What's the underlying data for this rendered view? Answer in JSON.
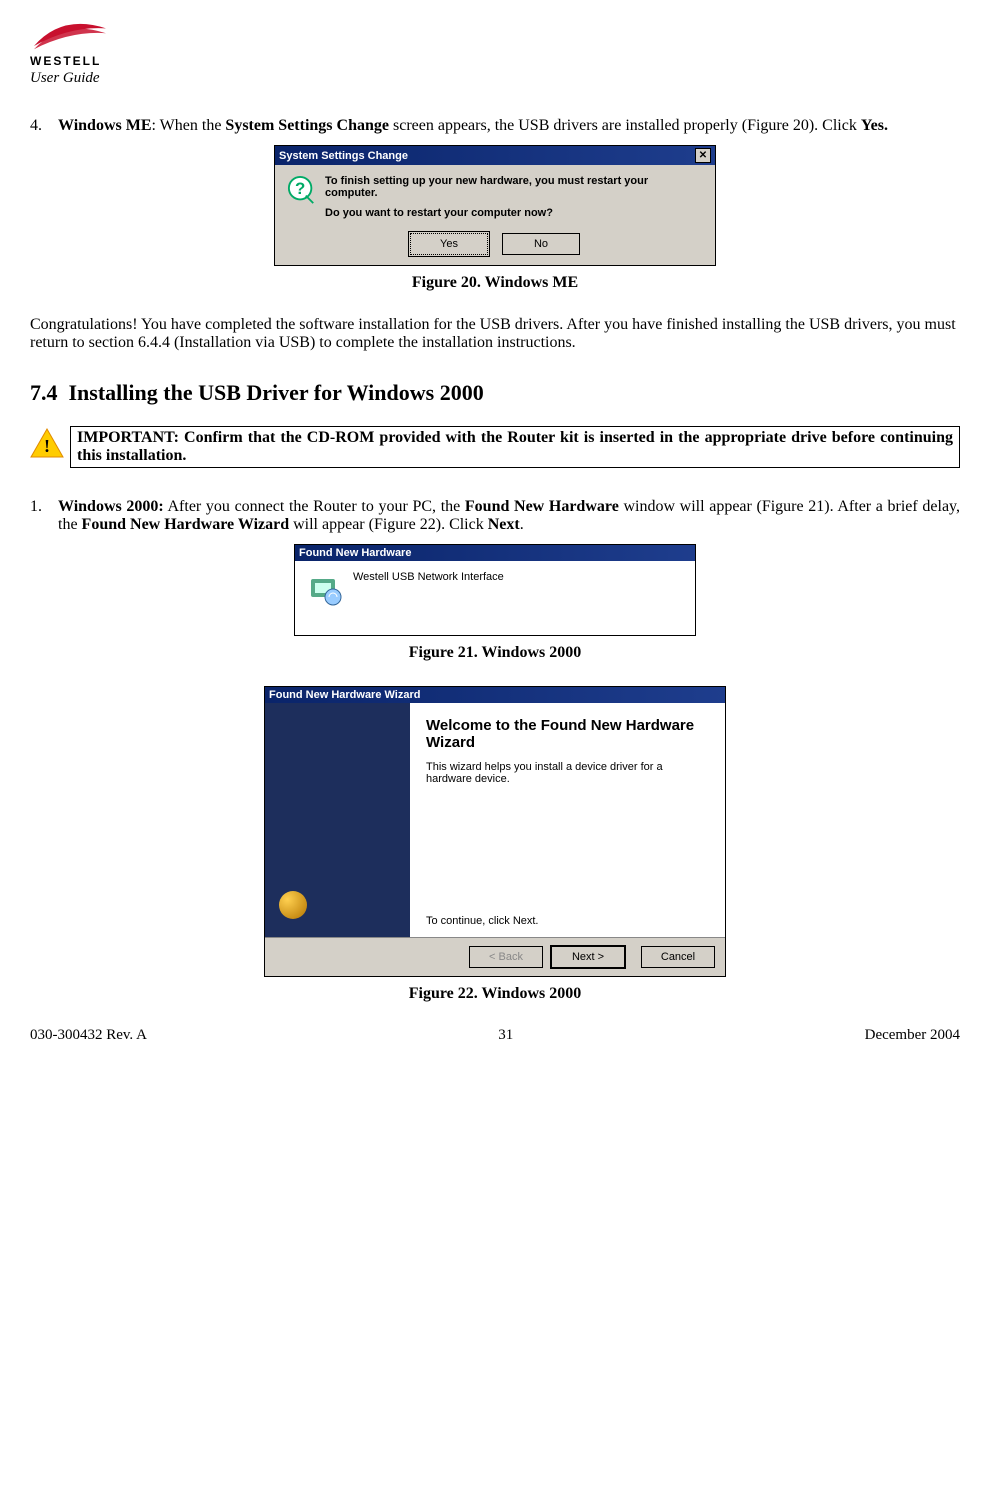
{
  "header": {
    "brand": "WESTELL",
    "subtitle": "User Guide"
  },
  "step4": {
    "number": "4.",
    "bold_os": "Windows ME",
    "text_after_os": ": When the ",
    "bold_screen": "System Settings Change",
    "text_tail": " screen appears, the USB drivers are installed properly (Figure 20). Click ",
    "bold_yes": "Yes."
  },
  "fig20": {
    "dialog_title": "System Settings Change",
    "line1": "To finish setting up your new hardware, you must restart your computer.",
    "line2": "Do you want to restart your computer now?",
    "btn_yes": "Yes",
    "btn_no": "No",
    "caption": "Figure 20. Windows ME"
  },
  "congrats": "Congratulations! You have completed the software installation for the USB drivers. After you have finished installing the USB drivers, you must return to section 6.4.4 (Installation via USB) to complete the installation instructions.",
  "section": {
    "num": "7.4",
    "title": "Installing the USB Driver for Windows 2000"
  },
  "important": "IMPORTANT: Confirm that the CD-ROM provided with the Router kit is inserted in the appropriate drive before continuing this installation.",
  "step1": {
    "number": "1.",
    "bold_os": "Windows 2000:",
    "text1": " After you connect the Router to your PC, the ",
    "bold_fnh": "Found New Hardware",
    "text2": " window will appear (Figure 21). After a brief delay, the ",
    "bold_wizard": "Found New Hardware Wizard",
    "text3": " will appear (Figure 22). Click ",
    "bold_next": "Next",
    "text4": "."
  },
  "fig21": {
    "title": "Found New Hardware",
    "device": "Westell USB Network Interface",
    "caption": "Figure 21. Windows 2000"
  },
  "fig22": {
    "title": "Found New Hardware Wizard",
    "heading": "Welcome to the Found New Hardware Wizard",
    "body": "This wizard helps you install a device driver for a hardware device.",
    "continue": "To continue, click Next.",
    "btn_back": "< Back",
    "btn_next": "Next >",
    "btn_cancel": "Cancel",
    "caption": "Figure 22. Windows 2000"
  },
  "footer": {
    "left": "030-300432 Rev. A",
    "center": "31",
    "right": "December 2004"
  }
}
